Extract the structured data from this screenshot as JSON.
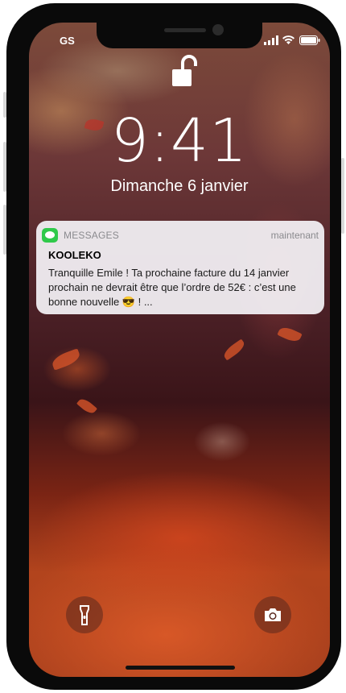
{
  "status_bar": {
    "carrier": "GS",
    "signal_icon": "signal-bars-icon",
    "wifi_icon": "wifi-icon",
    "battery_icon": "battery-icon"
  },
  "lock_screen": {
    "lock_icon": "unlocked-padlock-icon",
    "time": "9:41",
    "date": "Dimanche 6 janvier"
  },
  "notification": {
    "app_icon": "messages-app-icon",
    "app_name": "MESSAGES",
    "time": "maintenant",
    "title": "KOOLEKO",
    "body": "Tranquille Emile ! Ta prochaine facture du 14 janvier prochain ne devrait être que l’ordre de 52€ : c’est une bonne nouvelle 😎 ! ..."
  },
  "bottom_controls": {
    "flashlight_icon": "flashlight-icon",
    "camera_icon": "camera-icon"
  },
  "colors": {
    "notification_bg": "#f4f2f6",
    "messages_green": "#2fc94a",
    "frame": "#0a0a0a"
  }
}
